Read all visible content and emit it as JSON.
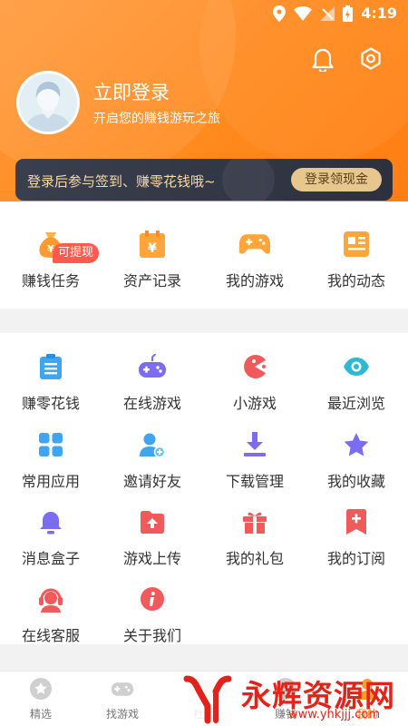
{
  "status_bar": {
    "time": "4:19"
  },
  "header": {
    "login_title": "立即登录",
    "login_subtitle": "开启您的赚钱游玩之旅",
    "icons": {
      "bell": "bell-icon",
      "settings": "settings-icon"
    }
  },
  "promo": {
    "text": "登录后参与签到、赚零花钱哦~",
    "button": "登录领现金"
  },
  "top_grid": {
    "items": [
      {
        "label": "赚钱任务",
        "icon": "money-bag-icon",
        "badge": "可提现"
      },
      {
        "label": "资产记录",
        "icon": "asset-record-icon"
      },
      {
        "label": "我的游戏",
        "icon": "gamepad-icon"
      },
      {
        "label": "我的动态",
        "icon": "news-icon"
      }
    ]
  },
  "tools_grid": {
    "items": [
      {
        "label": "赚零花钱",
        "icon": "clipboard-list-icon"
      },
      {
        "label": "在线游戏",
        "icon": "gamepad-icon"
      },
      {
        "label": "小游戏",
        "icon": "pacman-icon"
      },
      {
        "label": "最近浏览",
        "icon": "eye-icon"
      },
      {
        "label": "常用应用",
        "icon": "apps-grid-icon"
      },
      {
        "label": "邀请好友",
        "icon": "add-friend-icon"
      },
      {
        "label": "下载管理",
        "icon": "download-icon"
      },
      {
        "label": "我的收藏",
        "icon": "star-icon"
      },
      {
        "label": "消息盒子",
        "icon": "bell-icon"
      },
      {
        "label": "游戏上传",
        "icon": "folder-upload-icon"
      },
      {
        "label": "我的礼包",
        "icon": "gift-icon"
      },
      {
        "label": "我的订阅",
        "icon": "bookmark-plus-icon"
      },
      {
        "label": "在线客服",
        "icon": "headset-icon"
      },
      {
        "label": "关于我们",
        "icon": "info-icon"
      }
    ]
  },
  "tab_bar": {
    "tabs": [
      {
        "label": "精选",
        "icon": "star-badge-icon"
      },
      {
        "label": "找游戏",
        "icon": "gamepad-icon"
      },
      {
        "label": "社区",
        "icon": "community-icon"
      },
      {
        "label": "赚钱",
        "icon": "coin-icon"
      },
      {
        "label": "我的",
        "icon": "user-icon"
      }
    ]
  },
  "watermark": {
    "text": "永辉资源网",
    "url": "www.yhkjjj.com"
  },
  "colors": {
    "accent": "#ff8a1e",
    "promo_bg": "#2f3441",
    "promo_text": "#f7d9a6",
    "badge": "#ff5a4e"
  }
}
